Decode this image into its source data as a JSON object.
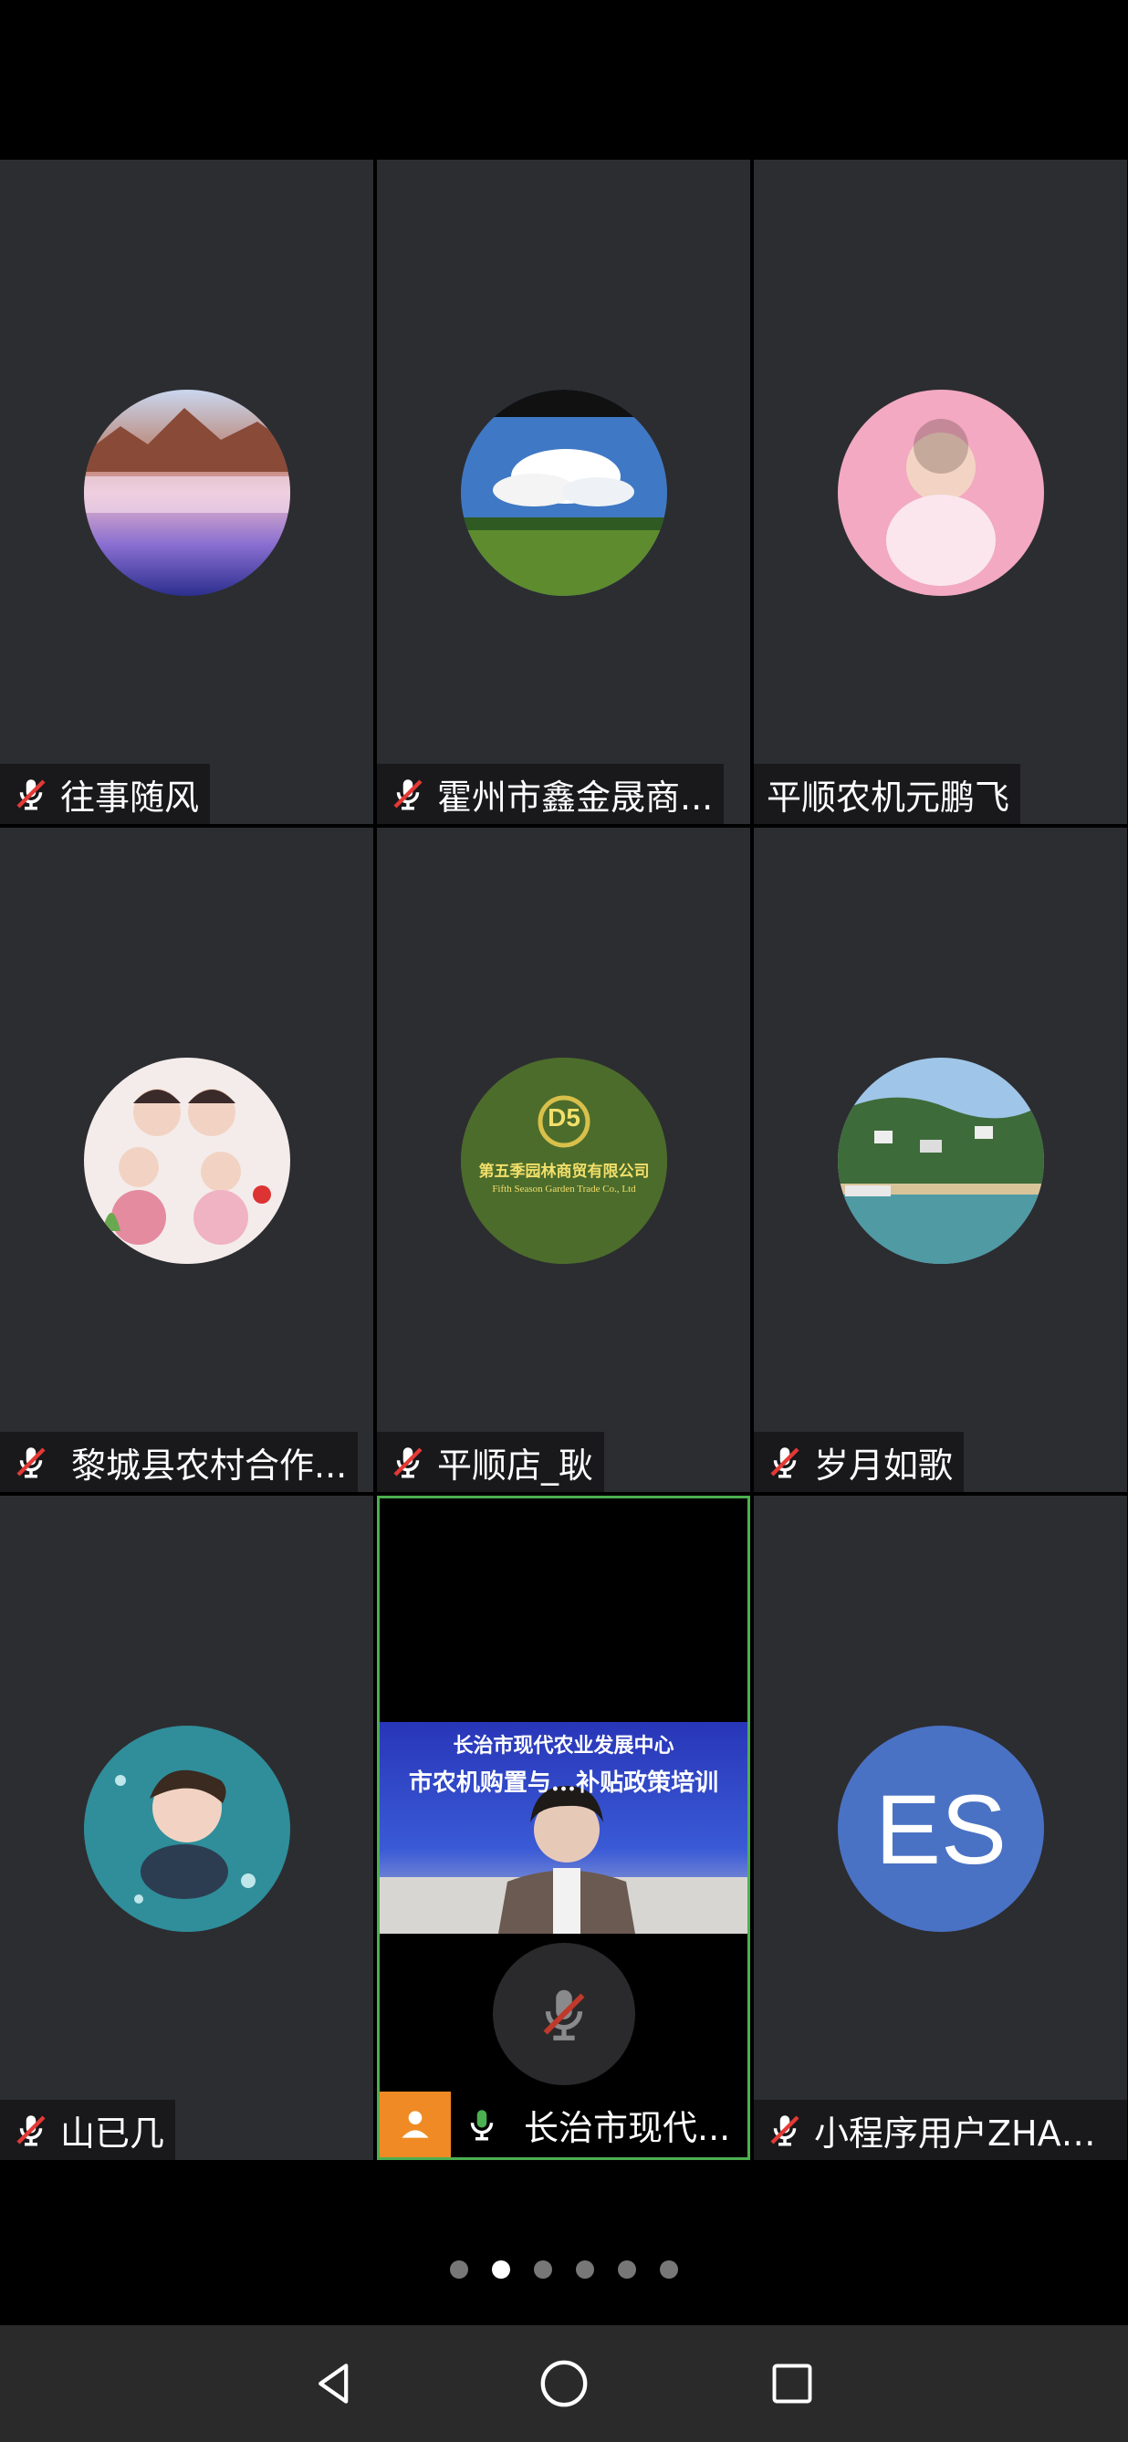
{
  "participants": [
    {
      "name": "往事随风",
      "muted": true,
      "avatar": "landscape-lake-avatar"
    },
    {
      "name": "霍州市鑫金晟商...",
      "muted": true,
      "avatar": "sky-cloud-field-avatar"
    },
    {
      "name": "平顺农机元鹏飞",
      "muted": false,
      "avatar": "baby-photo-avatar"
    },
    {
      "name": "黎城县农村合作...",
      "muted": true,
      "avatar": "cartoon-family-avatar"
    },
    {
      "name": "平顺店_耿",
      "muted": true,
      "avatar": "company-logo-avatar"
    },
    {
      "name": "岁月如歌",
      "muted": true,
      "avatar": "coastal-town-avatar"
    },
    {
      "name": "山已几",
      "muted": true,
      "avatar": "cartoon-boy-avatar"
    },
    {
      "name": "长治市现代...",
      "muted": false,
      "speaking": true,
      "avatar": "video-feed"
    },
    {
      "name": "小程序用户ZHA6...",
      "muted": true,
      "avatar": "initials-avatar"
    }
  ],
  "logo": {
    "line1": "第五季园林商贸有限公司",
    "line2": "Fifth Season Garden Trade Co., Ltd",
    "mark": "D5"
  },
  "video": {
    "line1": "长治市现代农业发展中心",
    "line2": "市农机购置与...补贴政策培训"
  },
  "initials": "ES",
  "pager": {
    "count": 6,
    "active": 1
  },
  "colors": {
    "tile": "#2c2d31",
    "active_border": "#4caf50",
    "badge": "#f08a24",
    "initials_bg": "#4a72c4"
  }
}
